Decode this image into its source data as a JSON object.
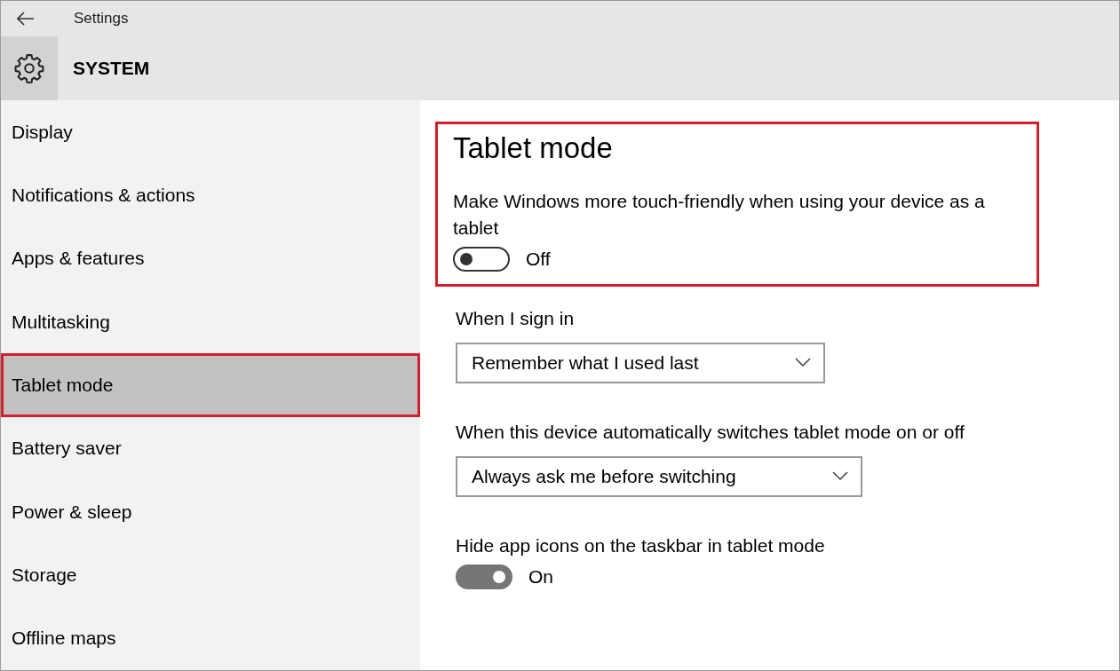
{
  "window": {
    "title": "Settings"
  },
  "header": {
    "title": "SYSTEM"
  },
  "sidebar": {
    "items": [
      {
        "label": "Display",
        "selected": false,
        "highlighted": false
      },
      {
        "label": "Notifications & actions",
        "selected": false,
        "highlighted": false
      },
      {
        "label": "Apps & features",
        "selected": false,
        "highlighted": false
      },
      {
        "label": "Multitasking",
        "selected": false,
        "highlighted": false
      },
      {
        "label": "Tablet mode",
        "selected": true,
        "highlighted": true
      },
      {
        "label": "Battery saver",
        "selected": false,
        "highlighted": false
      },
      {
        "label": "Power & sleep",
        "selected": false,
        "highlighted": false
      },
      {
        "label": "Storage",
        "selected": false,
        "highlighted": false
      },
      {
        "label": "Offline maps",
        "selected": false,
        "highlighted": false
      }
    ]
  },
  "content": {
    "highlight_frame": {
      "title": "Tablet mode",
      "settings": [
        {
          "kind": "toggle",
          "label": "Make Windows more touch-friendly when using your device as a tablet",
          "on": false,
          "state_label": "Off"
        }
      ]
    },
    "settings": [
      {
        "kind": "dropdown",
        "label": "When I sign in",
        "value": "Remember what I used last"
      },
      {
        "kind": "dropdown",
        "label": "When this device automatically switches tablet mode on or off",
        "value": "Always ask me before switching"
      },
      {
        "kind": "toggle",
        "label": "Hide app icons on the taskbar in tablet mode",
        "on": true,
        "state_label": "On"
      }
    ]
  }
}
